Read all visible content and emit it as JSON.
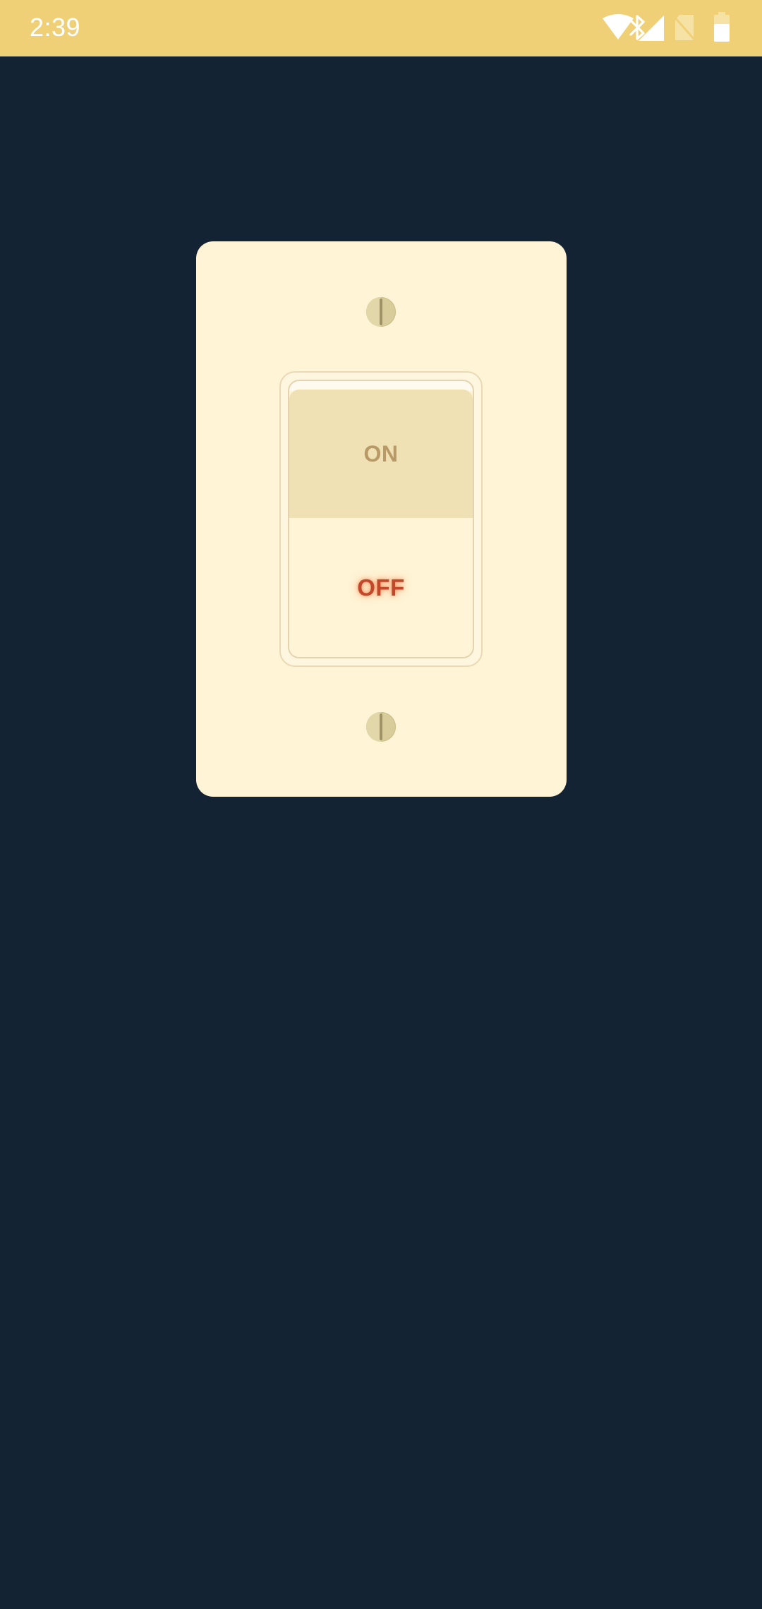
{
  "status_bar": {
    "time": "2:39",
    "icons": [
      "bluetooth-icon",
      "wifi-icon",
      "cell-signal-icon",
      "no-sim-icon",
      "battery-icon"
    ],
    "background_color": "#f0d077"
  },
  "app": {
    "background_color": "#142334",
    "switch": {
      "on_label": "ON",
      "off_label": "OFF",
      "state": "off",
      "plate_color": "#fff4d6",
      "active_label_color": "#c2482b"
    }
  }
}
